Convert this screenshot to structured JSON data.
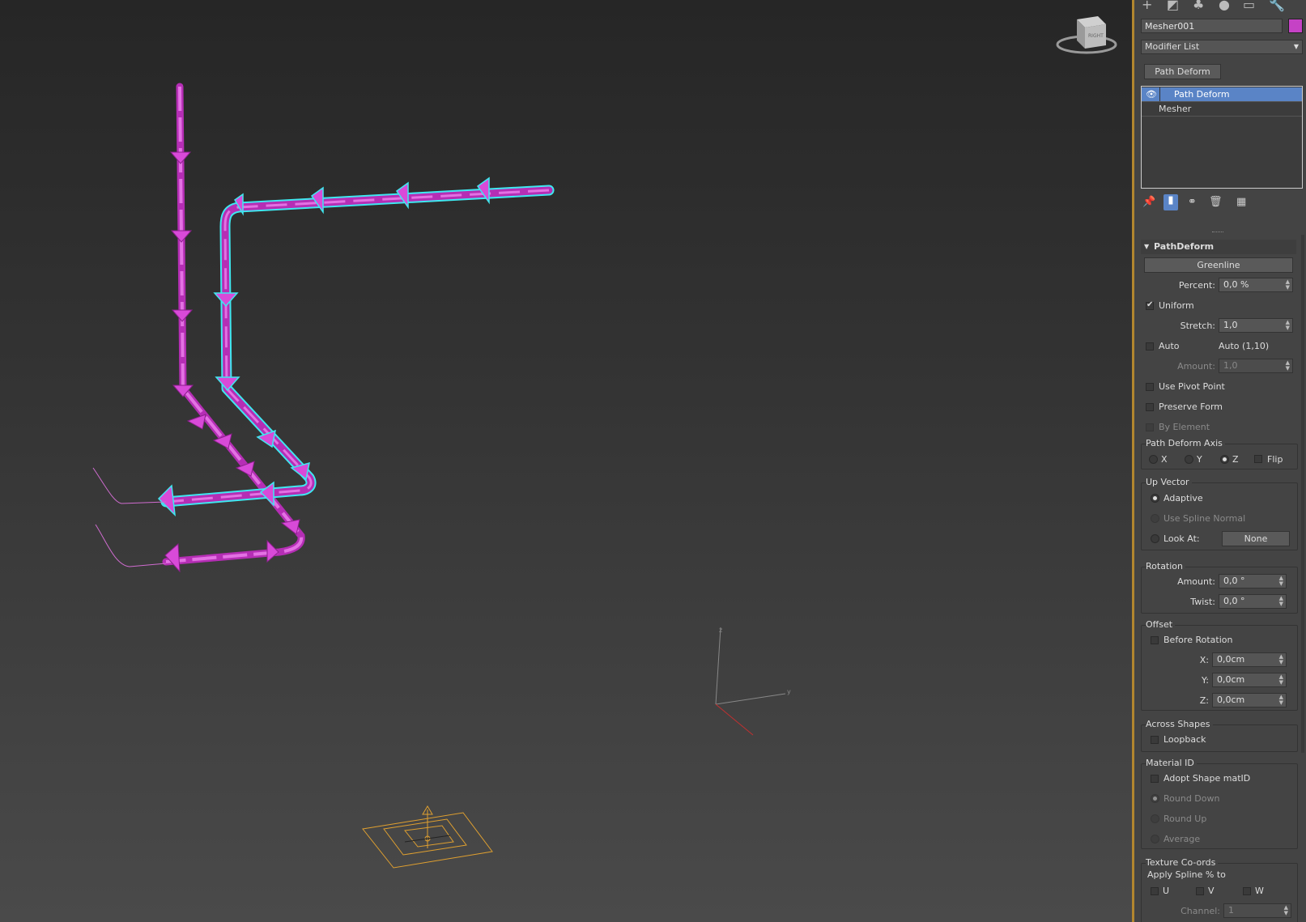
{
  "viewport": {
    "viewcube_label": "RIGHT",
    "axis_labels": {
      "z": "z",
      "y": "y"
    }
  },
  "panel": {
    "tabs": [
      "create-icon",
      "modify-icon",
      "hierarchy-icon",
      "motion-icon",
      "display-icon",
      "utilities-icon"
    ],
    "object_name": "Mesher001",
    "object_color": "#c542c5",
    "modifier_list": "Modifier List",
    "modifier_set_button": "Path Deform",
    "stack": [
      {
        "label": "Path Deform",
        "selected": true
      },
      {
        "label": "Mesher",
        "selected": false
      }
    ],
    "rollout": {
      "title": "PathDeform",
      "path_button": "Greenline",
      "percent_label": "Percent:",
      "percent_value": "0,0 %",
      "uniform_label": "Uniform",
      "uniform_checked": true,
      "stretch_label": "Stretch:",
      "stretch_value": "1,0",
      "auto_label": "Auto",
      "auto_value_text": "Auto (1,10)",
      "amount_label": "Amount:",
      "amount_value": "1,0",
      "use_pivot_label": "Use Pivot Point",
      "preserve_form_label": "Preserve Form",
      "by_element_label": "By Element",
      "axis_group": {
        "title": "Path Deform Axis",
        "x": "X",
        "y": "Y",
        "z": "Z",
        "flip": "Flip",
        "selected": "Z"
      },
      "up_vector": {
        "title": "Up Vector",
        "adaptive": "Adaptive",
        "use_spline_normal": "Use Spline Normal",
        "look_at": "Look At:",
        "look_at_button": "None",
        "selected": "Adaptive"
      },
      "rotation": {
        "title": "Rotation",
        "amount_label": "Amount:",
        "amount_value": "0,0 °",
        "twist_label": "Twist:",
        "twist_value": "0,0 °"
      },
      "offset": {
        "title": "Offset",
        "before_rotation": "Before Rotation",
        "x_label": "X:",
        "x_value": "0,0cm",
        "y_label": "Y:",
        "y_value": "0,0cm",
        "z_label": "Z:",
        "z_value": "0,0cm"
      },
      "across_shapes": {
        "title": "Across Shapes",
        "loopback": "Loopback"
      },
      "material_id": {
        "title": "Material ID",
        "adopt": "Adopt Shape matID",
        "round_down": "Round Down",
        "round_up": "Round Up",
        "average": "Average"
      },
      "texture": {
        "title": "Texture Co-ords",
        "apply": "Apply Spline % to",
        "u": "U",
        "v": "V",
        "w": "W",
        "channel_label": "Channel:",
        "channel_value": "1"
      }
    }
  }
}
